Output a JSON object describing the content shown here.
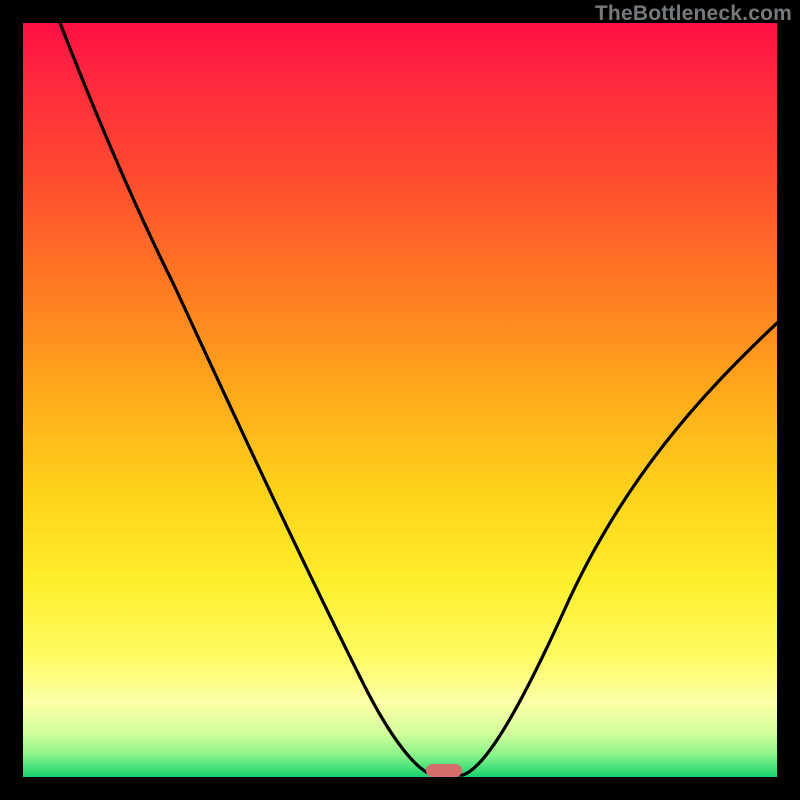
{
  "watermark": {
    "text": "TheBottleneck.com"
  },
  "chart_data": {
    "type": "line",
    "title": "",
    "xlabel": "",
    "ylabel": "",
    "xlim": [
      0,
      100
    ],
    "ylim": [
      0,
      100
    ],
    "grid": false,
    "series": [
      {
        "name": "bottleneck-curve",
        "x": [
          5,
          10,
          15,
          20,
          25,
          30,
          35,
          40,
          45,
          50,
          53,
          55,
          58,
          60,
          65,
          70,
          75,
          80,
          85,
          90,
          95,
          100
        ],
        "y": [
          100,
          88,
          77,
          67,
          59,
          51,
          42,
          33,
          23,
          12,
          4,
          0,
          0,
          4,
          13,
          22,
          30,
          37,
          44,
          50,
          55,
          60
        ]
      }
    ],
    "marker": {
      "x": 56,
      "y": 0,
      "color": "#d36e6a"
    },
    "background_gradient": {
      "stops": [
        {
          "pos": 0.0,
          "color": "#ff1045"
        },
        {
          "pos": 0.5,
          "color": "#ffac1a"
        },
        {
          "pos": 0.85,
          "color": "#fffc62"
        },
        {
          "pos": 1.0,
          "color": "#18d26e"
        }
      ]
    }
  }
}
